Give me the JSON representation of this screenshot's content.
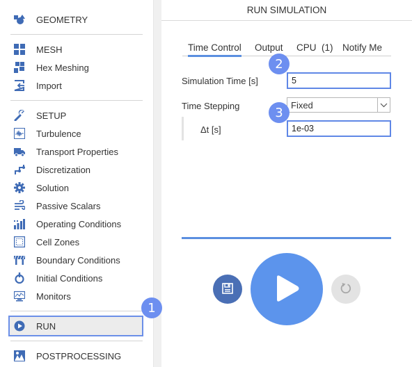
{
  "sidebar": {
    "items": [
      {
        "label": "GEOMETRY",
        "icon": "geometry-shapes-icon"
      },
      {
        "label": "MESH",
        "icon": "mesh-grid-icon"
      },
      {
        "label": "Hex Meshing",
        "icon": "hex-meshing-icon"
      },
      {
        "label": "Import",
        "icon": "import-icon"
      },
      {
        "label": "SETUP",
        "icon": "wrench-icon"
      },
      {
        "label": "Turbulence",
        "icon": "turbulence-wave-icon"
      },
      {
        "label": "Transport Properties",
        "icon": "truck-icon"
      },
      {
        "label": "Discretization",
        "icon": "discretization-icon"
      },
      {
        "label": "Solution",
        "icon": "gear-icon"
      },
      {
        "label": "Passive Scalars",
        "icon": "wind-icon"
      },
      {
        "label": "Operating Conditions",
        "icon": "bar-chart-icon"
      },
      {
        "label": "Cell Zones",
        "icon": "cell-zones-icon"
      },
      {
        "label": "Boundary Conditions",
        "icon": "boundary-conditions-icon"
      },
      {
        "label": "Initial Conditions",
        "icon": "stopwatch-icon"
      },
      {
        "label": "Monitors",
        "icon": "monitor-chart-icon"
      },
      {
        "label": "RUN",
        "icon": "play-circle-icon",
        "active": true
      },
      {
        "label": "POSTPROCESSING",
        "icon": "postprocessing-icon"
      }
    ]
  },
  "main": {
    "title": "RUN SIMULATION",
    "tabs": [
      {
        "label": "Time Control",
        "active": true
      },
      {
        "label": "Output"
      },
      {
        "label": "CPU  (1)"
      },
      {
        "label": "Notify Me"
      }
    ],
    "fields": {
      "simulation_time": {
        "label": "Simulation Time [s]",
        "value": "5"
      },
      "time_stepping": {
        "label": "Time Stepping",
        "value": "Fixed"
      },
      "delta_t": {
        "label": "Δt [s]",
        "value": "1e-03"
      }
    },
    "progress": 1.0,
    "buttons": {
      "save": "save-icon",
      "play": "play-icon",
      "reset": "reset-icon"
    }
  },
  "annotations": {
    "badge1": "1",
    "badge2": "2",
    "badge3": "3"
  },
  "colors": {
    "accent": "#5c94ec",
    "badge": "#6d8ff0",
    "icon": "#3f6bb5",
    "save_button": "#4a6fb5",
    "reset_button": "#e3e3e3"
  }
}
